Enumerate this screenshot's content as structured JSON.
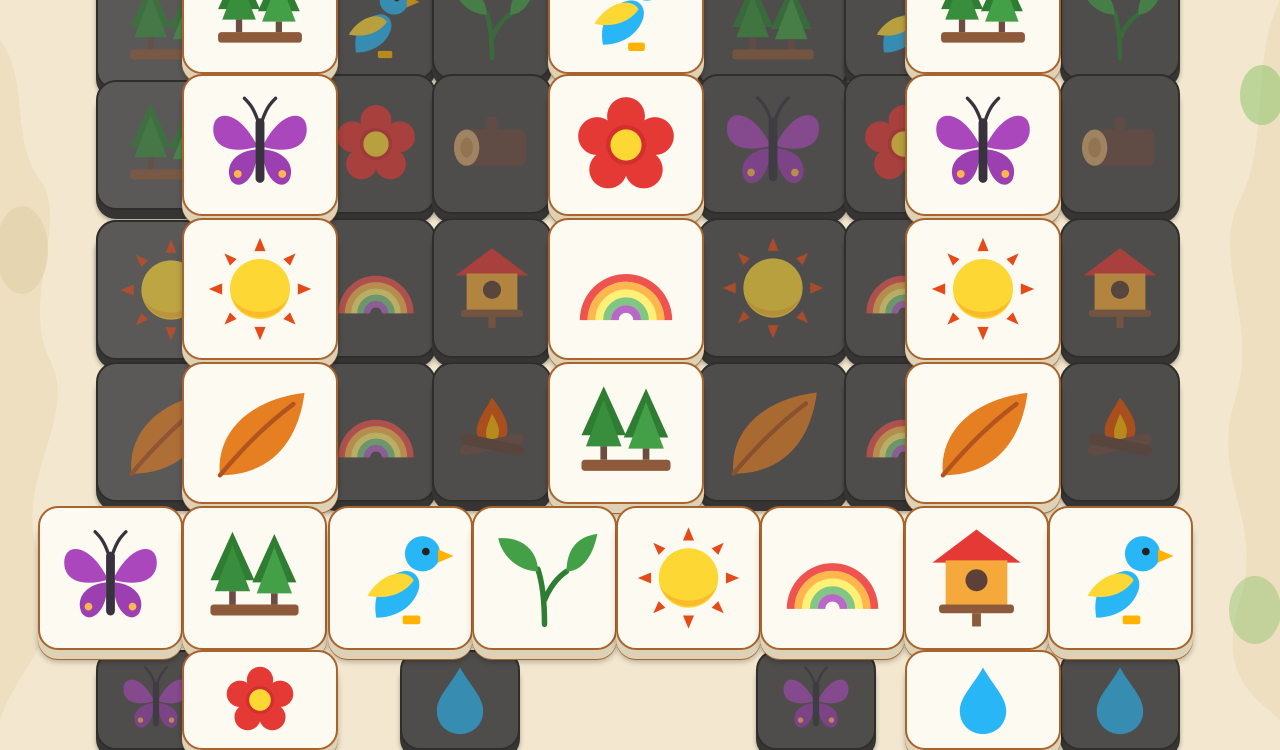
{
  "colors": {
    "background": "#f3e8cf",
    "tile_face": "#fdfaf1",
    "tile_edge": "#a8642c",
    "blocked_tile": "#4e4d4b"
  },
  "board": {
    "tiles": [
      {
        "id": "b1",
        "icon": "tree",
        "state": "blocked",
        "depth": 2
      },
      {
        "id": "b2",
        "icon": "tree",
        "state": "blocked",
        "depth": 2
      },
      {
        "id": "b3",
        "icon": "bird",
        "state": "blocked",
        "depth": 1
      },
      {
        "id": "b4",
        "icon": "sprout",
        "state": "blocked",
        "depth": 1
      },
      {
        "id": "b5",
        "icon": "tree",
        "state": "blocked",
        "depth": 1
      },
      {
        "id": "b6",
        "icon": "bird",
        "state": "blocked",
        "depth": 1
      },
      {
        "id": "b7",
        "icon": "sprout",
        "state": "blocked",
        "depth": 1
      },
      {
        "id": "b8",
        "icon": "butterfly",
        "state": "blocked",
        "depth": 2
      },
      {
        "id": "b9",
        "icon": "flower",
        "state": "blocked",
        "depth": 1
      },
      {
        "id": "b10",
        "icon": "log",
        "state": "blocked",
        "depth": 1
      },
      {
        "id": "b11",
        "icon": "butterfly",
        "state": "blocked",
        "depth": 1
      },
      {
        "id": "b12",
        "icon": "flower",
        "state": "blocked",
        "depth": 1
      },
      {
        "id": "b13",
        "icon": "log",
        "state": "blocked",
        "depth": 1
      },
      {
        "id": "b14",
        "icon": "sun",
        "state": "blocked",
        "depth": 2
      },
      {
        "id": "b15",
        "icon": "rainbow",
        "state": "blocked",
        "depth": 1
      },
      {
        "id": "b16",
        "icon": "birdhouse",
        "state": "blocked",
        "depth": 1
      },
      {
        "id": "b17",
        "icon": "sun",
        "state": "blocked",
        "depth": 1
      },
      {
        "id": "b18",
        "icon": "rainbow",
        "state": "blocked",
        "depth": 1
      },
      {
        "id": "b19",
        "icon": "birdhouse",
        "state": "blocked",
        "depth": 1
      },
      {
        "id": "b20",
        "icon": "leaf",
        "state": "blocked",
        "depth": 2
      },
      {
        "id": "b21",
        "icon": "rainbow",
        "state": "blocked",
        "depth": 1
      },
      {
        "id": "b22",
        "icon": "campfire",
        "state": "blocked",
        "depth": 1
      },
      {
        "id": "b23",
        "icon": "leaf",
        "state": "blocked",
        "depth": 1
      },
      {
        "id": "b24",
        "icon": "rainbow",
        "state": "blocked",
        "depth": 1
      },
      {
        "id": "b25",
        "icon": "campfire",
        "state": "blocked",
        "depth": 1
      },
      {
        "id": "b26",
        "icon": "butterfly",
        "state": "blocked",
        "depth": 1
      },
      {
        "id": "b27",
        "icon": "butterfly",
        "state": "blocked",
        "depth": 1
      },
      {
        "id": "b28",
        "icon": "drop",
        "state": "blocked",
        "depth": 1
      },
      {
        "id": "b29",
        "icon": "drop",
        "state": "blocked",
        "depth": 1
      },
      {
        "id": "f1",
        "icon": "tree",
        "state": "free"
      },
      {
        "id": "f2",
        "icon": "bird",
        "state": "free"
      },
      {
        "id": "f3",
        "icon": "tree",
        "state": "free"
      },
      {
        "id": "f4",
        "icon": "butterfly",
        "state": "free"
      },
      {
        "id": "f5",
        "icon": "flower",
        "state": "free"
      },
      {
        "id": "f6",
        "icon": "butterfly",
        "state": "free"
      },
      {
        "id": "f7",
        "icon": "sun",
        "state": "free"
      },
      {
        "id": "f8",
        "icon": "rainbow",
        "state": "free"
      },
      {
        "id": "f9",
        "icon": "sun",
        "state": "free"
      },
      {
        "id": "f10",
        "icon": "leaf",
        "state": "free"
      },
      {
        "id": "f11",
        "icon": "tree",
        "state": "free"
      },
      {
        "id": "f12",
        "icon": "leaf",
        "state": "free"
      },
      {
        "id": "f13",
        "icon": "butterfly",
        "state": "free"
      },
      {
        "id": "f14",
        "icon": "tree",
        "state": "free"
      },
      {
        "id": "f15",
        "icon": "bird",
        "state": "free"
      },
      {
        "id": "f16",
        "icon": "sprout",
        "state": "free"
      },
      {
        "id": "f17",
        "icon": "sun",
        "state": "free"
      },
      {
        "id": "f18",
        "icon": "rainbow",
        "state": "free"
      },
      {
        "id": "f19",
        "icon": "birdhouse",
        "state": "free"
      },
      {
        "id": "f20",
        "icon": "bird",
        "state": "free"
      },
      {
        "id": "f21",
        "icon": "flower",
        "state": "free"
      },
      {
        "id": "f22",
        "icon": "drop",
        "state": "free"
      }
    ]
  }
}
